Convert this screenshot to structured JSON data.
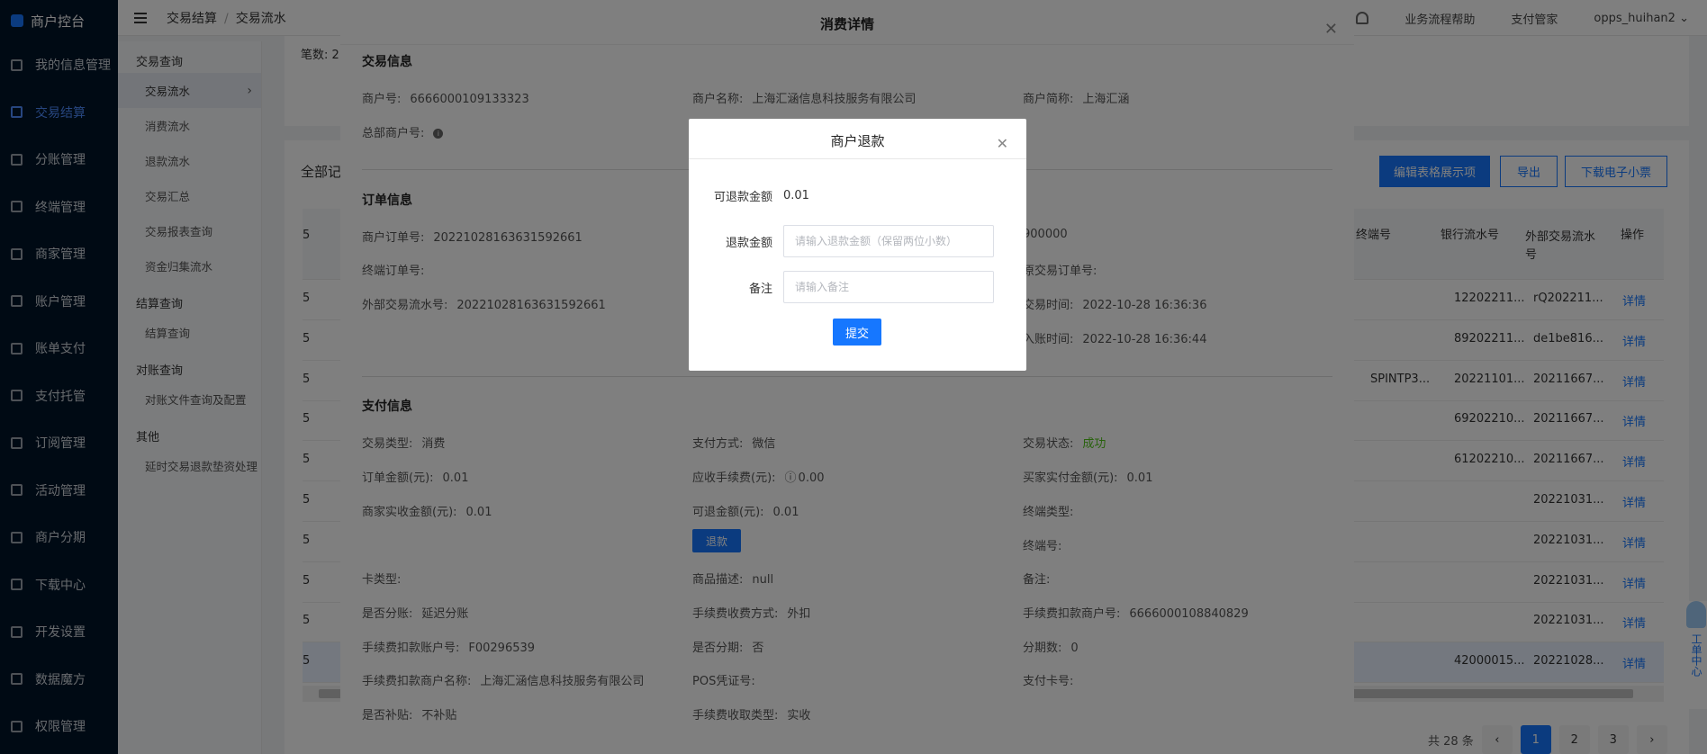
{
  "brand": {
    "title": "商户控台"
  },
  "sidebar": {
    "items": [
      {
        "label": "我的信息管理",
        "icon": "user-icon"
      },
      {
        "label": "交易结算",
        "icon": "list-icon",
        "active": true
      },
      {
        "label": "分账管理",
        "icon": "split-icon"
      },
      {
        "label": "终端管理",
        "icon": "terminal-icon"
      },
      {
        "label": "商家管理",
        "icon": "store-icon"
      },
      {
        "label": "账户管理",
        "icon": "account-icon"
      },
      {
        "label": "账单支付",
        "icon": "bill-icon"
      },
      {
        "label": "支付托管",
        "icon": "custody-icon"
      },
      {
        "label": "订阅管理",
        "icon": "subscribe-icon"
      },
      {
        "label": "活动管理",
        "icon": "activity-icon"
      },
      {
        "label": "商户分期",
        "icon": "installment-icon"
      },
      {
        "label": "下载中心",
        "icon": "download-icon"
      },
      {
        "label": "开发设置",
        "icon": "dev-settings-icon"
      },
      {
        "label": "数据魔方",
        "icon": "data-cube-icon"
      },
      {
        "label": "权限管理",
        "icon": "permission-icon"
      }
    ]
  },
  "submenu": {
    "group1": "交易查询",
    "g1_items": [
      "交易流水",
      "消费流水",
      "退款流水",
      "交易汇总",
      "交易报表查询",
      "资金归集流水"
    ],
    "group2": "结算查询",
    "g2_items": [
      "结算查询"
    ],
    "group3": "对账查询",
    "g3_items": [
      "对账文件查询及配置"
    ],
    "group4": "其他",
    "g4_items": [
      "延时交易退款垫资处理"
    ]
  },
  "topbar": {
    "breadcrumb": [
      "交易结算",
      "交易流水"
    ],
    "help": "业务流程帮助",
    "custody": "支付管家",
    "user": "opps_huihan2"
  },
  "page": {
    "count_label": "笔数: 2",
    "all_records": "全部记",
    "btn_edit_table": "编辑表格展示项",
    "btn_export": "导出",
    "btn_download_receipt": "下载电子小票",
    "helper_text": "工单中心"
  },
  "table": {
    "headers": [
      "终端号",
      "银行流水号",
      "外部交易流水号",
      "操作"
    ],
    "rows": [
      {
        "terminal": "",
        "bank": "12202211...",
        "ext": "rQ202211...",
        "op": "详情"
      },
      {
        "terminal": "",
        "bank": "89202211...",
        "ext": "de1be816...",
        "op": "详情"
      },
      {
        "terminal": "SPINTP3...",
        "bank": "20221101...",
        "ext": "20211667...",
        "op": "详情"
      },
      {
        "terminal": "",
        "bank": "69202210...",
        "ext": "20211667...",
        "op": "详情"
      },
      {
        "terminal": "",
        "bank": "61202210...",
        "ext": "20211667...",
        "op": "详情"
      },
      {
        "terminal": "",
        "bank": "",
        "ext": "20221031...",
        "op": "详情"
      },
      {
        "terminal": "",
        "bank": "",
        "ext": "20221031...",
        "op": "详情"
      },
      {
        "terminal": "",
        "bank": "",
        "ext": "20221031...",
        "op": "详情"
      },
      {
        "terminal": "",
        "bank": "",
        "ext": "20221031...",
        "op": "详情"
      },
      {
        "terminal": "",
        "bank": "42000015...",
        "ext": "20221028...",
        "op": "详情"
      }
    ],
    "left_col": "5"
  },
  "pagination": {
    "total": "共 28 条",
    "pages": [
      "1",
      "2",
      "3"
    ]
  },
  "drawer": {
    "title": "消费详情",
    "sec_trade": "交易信息",
    "merchant_no_label": "商户号:",
    "merchant_no": "6666000109133323",
    "merchant_name_label": "商户名称:",
    "merchant_name": "上海汇涵信息科技服务有限公司",
    "merchant_short_label": "商户简称:",
    "merchant_short": "上海汇涵",
    "hq_label": "总部商户号:",
    "sec_order": "订单信息",
    "order_no_label": "商户订单号:",
    "order_no": "20221028163631592661",
    "terminal_order_label": "终端订单号:",
    "ext_serial_label": "外部交易流水号:",
    "ext_serial": "20221028163631592661",
    "right_partial": "900000",
    "orig_order_label": "原交易订单号:",
    "trade_time_label": "交易时间:",
    "trade_time": "2022-10-28 16:36:36",
    "entry_time_label": "入账时间:",
    "entry_time": "2022-10-28 16:36:44",
    "sec_pay": "支付信息",
    "trade_type_label": "交易类型:",
    "trade_type": "消费",
    "pay_method_label": "支付方式:",
    "pay_method": "微信",
    "trade_status_label": "交易状态:",
    "trade_status": "成功",
    "order_amt_label": "订单金额(元):",
    "order_amt": "0.01",
    "fee_label": "应收手续费(元):",
    "fee": "0.00",
    "buyer_paid_label": "买家实付金额(元):",
    "buyer_paid": "0.01",
    "merchant_recv_label": "商家实收金额(元):",
    "merchant_recv": "0.01",
    "refundable_label": "可退金额(元):",
    "refundable": "0.01",
    "terminal_type_label": "终端类型:",
    "refund_btn": "退款",
    "terminal_no_label": "终端号:",
    "card_type_label": "卡类型:",
    "goods_desc_label": "商品描述:",
    "goods_desc": "null",
    "remark_label": "备注:",
    "split_label": "是否分账:",
    "split": "延迟分账",
    "fee_mode_label": "手续费收费方式:",
    "fee_mode": "外扣",
    "fee_merchant_label": "手续费扣款商户号:",
    "fee_merchant": "6666000108840829",
    "fee_account_label": "手续费扣款账户号:",
    "fee_account": "F00296539",
    "installment_label": "是否分期:",
    "installment": "否",
    "periods_label": "分期数:",
    "periods": "0",
    "fee_merchant_name_label": "手续费扣款商户名称:",
    "fee_merchant_name": "上海汇涵信息科技服务有限公司",
    "pos_label": "POS凭证号:",
    "card_no_label": "支付卡号:",
    "subsidy_label": "是否补贴:",
    "subsidy": "不补贴",
    "fee_collect_label": "手续费收取类型:",
    "fee_collect": "实收"
  },
  "dialog": {
    "title": "商户退款",
    "refundable_label": "可退款金额",
    "refundable_value": "0.01",
    "amount_label": "退款金额",
    "amount_placeholder": "请输入退款金额（保留两位小数）",
    "remark_label": "备注",
    "remark_placeholder": "请输入备注",
    "submit": "提交"
  }
}
